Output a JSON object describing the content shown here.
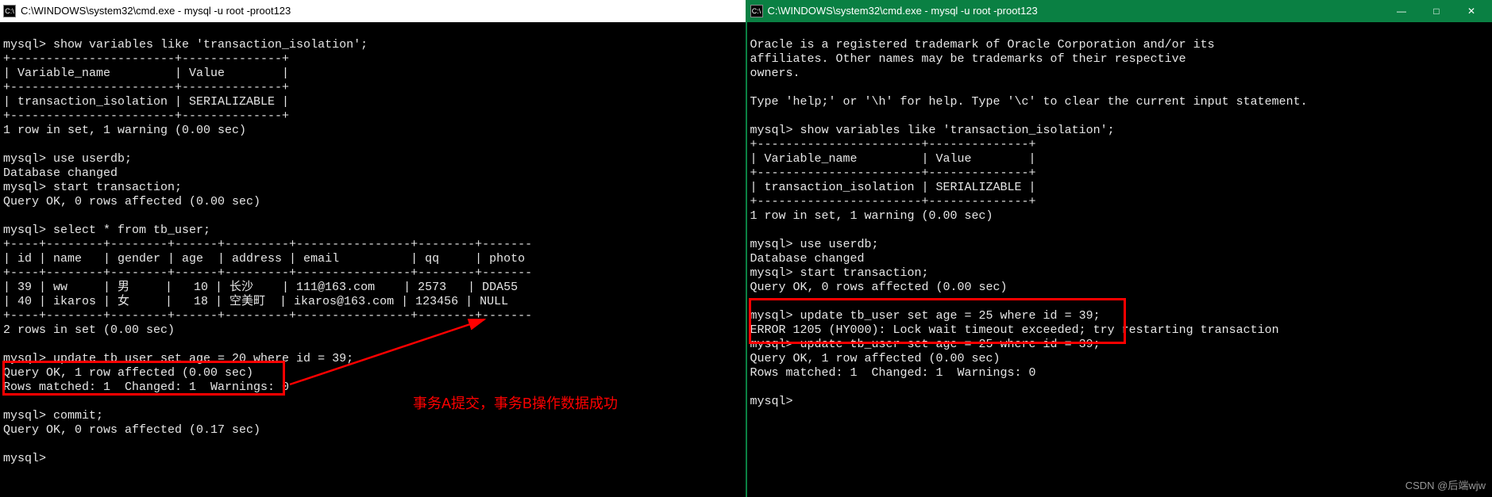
{
  "left": {
    "title": "C:\\WINDOWS\\system32\\cmd.exe - mysql  -u root -proot123",
    "lines": {
      "l1": "mysql> show variables like 'transaction_isolation';",
      "l2": "+-----------------------+--------------+",
      "l3": "| Variable_name         | Value        |",
      "l4": "+-----------------------+--------------+",
      "l5": "| transaction_isolation | SERIALIZABLE |",
      "l6": "+-----------------------+--------------+",
      "l7": "1 row in set, 1 warning (0.00 sec)",
      "l8": "",
      "l9": "mysql> use userdb;",
      "l10": "Database changed",
      "l11": "mysql> start transaction;",
      "l12": "Query OK, 0 rows affected (0.00 sec)",
      "l13": "",
      "l14": "mysql> select * from tb_user;",
      "l15": "+----+--------+--------+------+---------+----------------+--------+-------",
      "l16": "| id | name   | gender | age  | address | email          | qq     | photo",
      "l17": "+----+--------+--------+------+---------+----------------+--------+-------",
      "l18": "| 39 | ww     | 男     |   10 | 长沙    | 111@163.com    | 2573   | DDA55",
      "l19": "| 40 | ikaros | 女     |   18 | 空美町  | ikaros@163.com | 123456 | NULL",
      "l20": "+----+--------+--------+------+---------+----------------+--------+-------",
      "l21": "2 rows in set (0.00 sec)",
      "l22": "",
      "l23": "mysql> update tb_user set age = 20 where id = 39;",
      "l24": "Query OK, 1 row affected (0.00 sec)",
      "l25": "Rows matched: 1  Changed: 1  Warnings: 0",
      "l26": "",
      "l27": "mysql> commit;",
      "l28": "Query OK, 0 rows affected (0.17 sec)",
      "l29": "",
      "l30": "mysql>"
    }
  },
  "right": {
    "title": "C:\\WINDOWS\\system32\\cmd.exe - mysql  -u root -proot123",
    "min_label": "—",
    "max_label": "□",
    "close_label": "✕",
    "lines": {
      "r1": "Oracle is a registered trademark of Oracle Corporation and/or its",
      "r2": "affiliates. Other names may be trademarks of their respective",
      "r3": "owners.",
      "r4": "",
      "r5": "Type 'help;' or '\\h' for help. Type '\\c' to clear the current input statement.",
      "r6": "",
      "r7": "mysql> show variables like 'transaction_isolation';",
      "r8": "+-----------------------+--------------+",
      "r9": "| Variable_name         | Value        |",
      "r10": "+-----------------------+--------------+",
      "r11": "| transaction_isolation | SERIALIZABLE |",
      "r12": "+-----------------------+--------------+",
      "r13": "1 row in set, 1 warning (0.00 sec)",
      "r14": "",
      "r15": "mysql> use userdb;",
      "r16": "Database changed",
      "r17": "mysql> start transaction;",
      "r18": "Query OK, 0 rows affected (0.00 sec)",
      "r19": "",
      "r20": "mysql> update tb_user set age = 25 where id = 39;",
      "r21": "ERROR 1205 (HY000): Lock wait timeout exceeded; try restarting transaction",
      "r22": "mysql> update tb_user set age = 25 where id = 39;",
      "r23": "Query OK, 1 row affected (0.00 sec)",
      "r24": "Rows matched: 1  Changed: 1  Warnings: 0",
      "r25": "",
      "r26": "mysql>"
    }
  },
  "annotation_text": "事务A提交，事务B操作数据成功",
  "watermark": "CSDN @后端wjw"
}
